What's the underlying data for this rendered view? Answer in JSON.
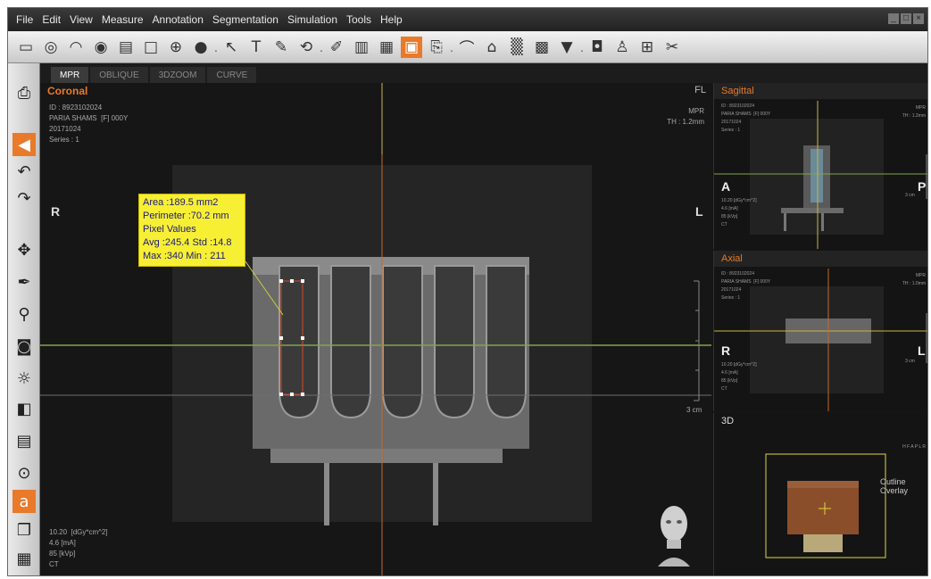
{
  "menu": [
    "File",
    "Edit",
    "View",
    "Measure",
    "Annotation",
    "Segmentation",
    "Simulation",
    "Tools",
    "Help"
  ],
  "window_controls": [
    "_",
    "□",
    "×"
  ],
  "toolbar_icons": [
    "ruler-icon",
    "angle-icon",
    "protractor-icon",
    "roi-icon",
    "profile-icon",
    "window-icon",
    "crosshair-icon",
    "bucket-icon",
    "arrow-icon",
    "text-icon",
    "pencil-icon",
    "lasso-icon",
    "edit-icon",
    "report-icon",
    "chart-icon",
    "layers-icon",
    "export-icon",
    "curve-icon",
    "volume-icon",
    "teeth-icon",
    "panorama-icon",
    "implant-icon",
    "camera-icon",
    "person-icon",
    "layout-icon",
    "tools-icon"
  ],
  "tabs": [
    "MPR",
    "OBLIQUE",
    "3DZOOM",
    "CURVE"
  ],
  "main": {
    "title": "Coronal",
    "top_right": "FL",
    "patient_info": "ID : 8923102024\nPARIA SHAMS  [F] 000Y\n20171024\nSeries : 1",
    "mode_info": "MPR\nTH : 1.2mm",
    "orient_right": "R",
    "orient_left": "L",
    "scale": "3 cm",
    "dose_info": "10.20  [dGy*cm^2]\n4.6 [mA]\n85 [kVp]\nCT",
    "measurement": {
      "area": "Area :189.5  mm2",
      "perimeter": "Perimeter :70.2 mm",
      "pixel_values": "Pixel Values",
      "avg_std": "Avg :245.4 Std :14.8",
      "max_min": "Max :340   Min : 211"
    }
  },
  "sagittal": {
    "title": "Sagittal",
    "info": "ID : 8923102024\nPARIA SHAMS  [F] 000Y\n20171024\nSeries : 1",
    "mode": "MPR\nTH : 1.2mm",
    "orient_a": "A",
    "orient_p": "P",
    "dose": "10.20 [dGy*cm^2]\n4.6 [mA]\n85 [kVp]\nCT",
    "scale": "3 cm"
  },
  "axial": {
    "title": "Axial",
    "info": "ID : 8923102024\nPARIA SHAMS  [F] 000Y\n20171024\nSeries : 1",
    "mode": "MPR\nTH : 1.0mm",
    "orient_r": "R",
    "orient_l": "L",
    "dose": "10.20 [dGy*cm^2]\n4.6 [mA]\n85 [kVp]\nCT",
    "scale": "3 cm"
  },
  "view3d": {
    "title": "3D",
    "orient_letters": "H F A P L R",
    "overlay_label": "Outline Overlay"
  },
  "colors": {
    "accent": "#e87a2a",
    "measurement_bg": "#f7ef34",
    "crosshair_green": "#7fa64a",
    "crosshair_orange": "#c4692c",
    "crosshair_yellow": "#c9b64a"
  }
}
